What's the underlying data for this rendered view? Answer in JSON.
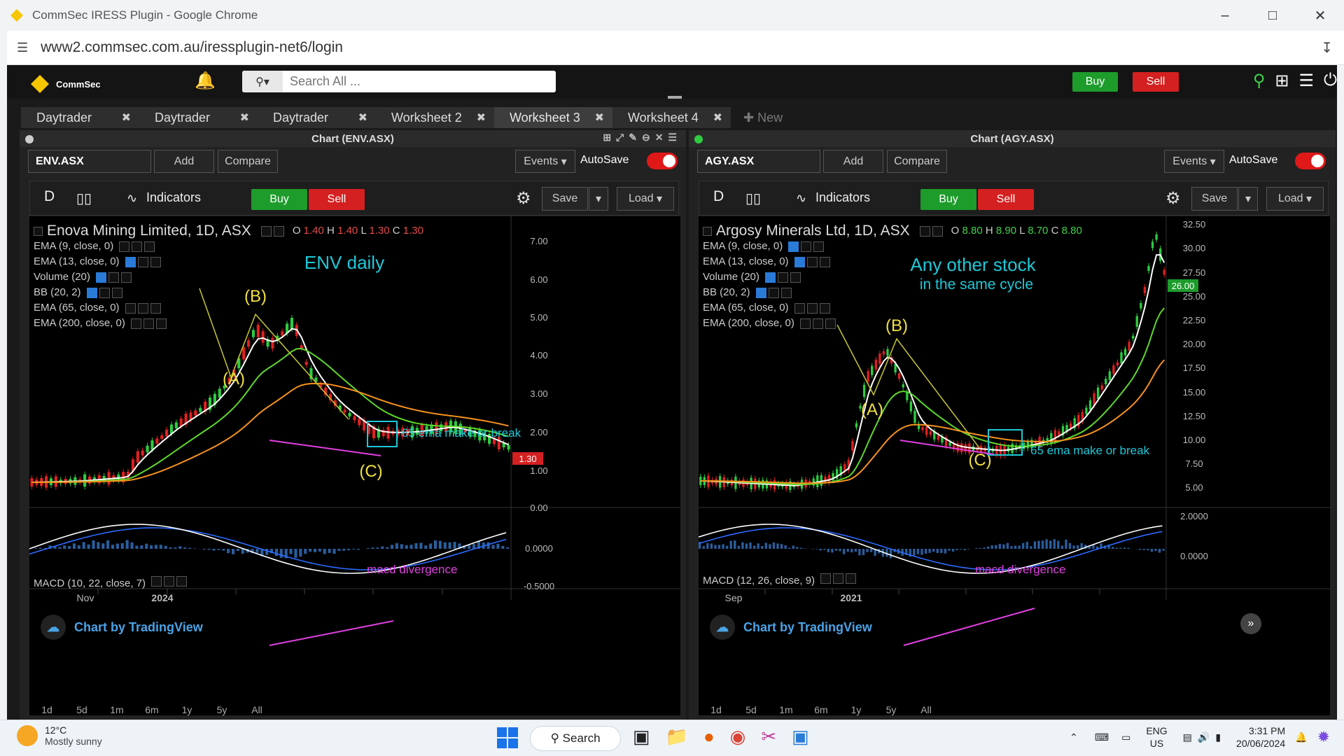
{
  "browser": {
    "window_title": "CommSec IRESS Plugin - Google Chrome",
    "url": "www2.commsec.com.au/iressplugin-net6/login"
  },
  "app": {
    "logo_text": "CommSec",
    "search_placeholder": "Search All ...",
    "buy_label": "Buy",
    "sell_label": "Sell"
  },
  "tabs": [
    {
      "label": "Daytrader"
    },
    {
      "label": "Daytrader"
    },
    {
      "label": "Daytrader"
    },
    {
      "label": "Worksheet 2"
    },
    {
      "label": "Worksheet 3"
    },
    {
      "label": "Worksheet 4"
    }
  ],
  "new_tab_label": "New",
  "panels": [
    {
      "title": "Chart (ENV.ASX)",
      "symbol": "ENV.ASX",
      "add_label": "Add",
      "compare_label": "Compare",
      "events_label": "Events",
      "autosave_label": "AutoSave",
      "interval": "D",
      "indicators_label": "Indicators",
      "buy_label": "Buy",
      "sell_label": "Sell",
      "save_label": "Save",
      "load_label": "Load",
      "chart_title": "Enova Mining Limited, 1D, ASX",
      "ohlc": {
        "o_label": "O",
        "o": "1.40",
        "h_label": "H",
        "h": "1.40",
        "l_label": "L",
        "l": "1.30",
        "c_label": "C",
        "c": "1.30"
      },
      "ohlc_color": "#e54b4b",
      "indicators": [
        "EMA (9, close, 0)",
        "EMA (13, close, 0)",
        "Volume (20)",
        "BB (20, 2)",
        "EMA (65, close, 0)",
        "EMA (200, close, 0)"
      ],
      "annotations": {
        "title": "ENV daily",
        "b": "(B)",
        "a": "(A)",
        "c": "(C)",
        "box": "65 ema make or break",
        "macd": "macd divergence"
      },
      "price_axis": [
        "7.00",
        "6.00",
        "5.00",
        "4.00",
        "3.00",
        "2.00",
        "1.00",
        "0.00"
      ],
      "last_price": "1.30",
      "last_price_color": "#d42020",
      "macd_label": "MACD (10, 22, close, 7)",
      "macd_axis": [
        "0.0000",
        "-0.5000"
      ],
      "time_axis": [
        "Nov",
        "2024"
      ],
      "tv_label": "Chart by TradingView",
      "ranges": [
        "1d",
        "5d",
        "1m",
        "6m",
        "1y",
        "5y",
        "All"
      ]
    },
    {
      "title": "Chart (AGY.ASX)",
      "symbol": "AGY.ASX",
      "add_label": "Add",
      "compare_label": "Compare",
      "events_label": "Events",
      "autosave_label": "AutoSave",
      "interval": "D",
      "indicators_label": "Indicators",
      "buy_label": "Buy",
      "sell_label": "Sell",
      "save_label": "Save",
      "load_label": "Load",
      "chart_title": "Argosy Minerals Ltd, 1D, ASX",
      "ohlc": {
        "o_label": "O",
        "o": "8.80",
        "h_label": "H",
        "h": "8.90",
        "l_label": "L",
        "l": "8.70",
        "c_label": "C",
        "c": "8.80"
      },
      "ohlc_color": "#3fd24a",
      "indicators": [
        "EMA (9, close, 0)",
        "EMA (13, close, 0)",
        "Volume (20)",
        "BB (20, 2)",
        "EMA (65, close, 0)",
        "EMA (200, close, 0)"
      ],
      "annotations": {
        "title": "Any other stock",
        "subtitle": "in the same cycle",
        "b": "(B)",
        "a": "(A)",
        "c": "(C)",
        "box": "65 ema make or break",
        "macd": "macd divergence"
      },
      "price_axis": [
        "32.50",
        "30.00",
        "27.50",
        "25.00",
        "22.50",
        "20.00",
        "17.50",
        "15.00",
        "12.50",
        "10.00",
        "7.50",
        "5.00"
      ],
      "last_price": "26.00",
      "last_price_color": "#1d9c2b",
      "macd_label": "MACD (12, 26, close, 9)",
      "macd_axis": [
        "2.0000",
        "0.0000"
      ],
      "time_axis": [
        "Sep",
        "2021"
      ],
      "tv_label": "Chart by TradingView",
      "ranges": [
        "1d",
        "5d",
        "1m",
        "6m",
        "1y",
        "5y",
        "All"
      ]
    }
  ],
  "taskbar": {
    "temp": "12°C",
    "weather": "Mostly sunny",
    "search_label": "Search",
    "lang1": "ENG",
    "lang2": "US",
    "time": "3:31 PM",
    "date": "20/06/2024"
  }
}
